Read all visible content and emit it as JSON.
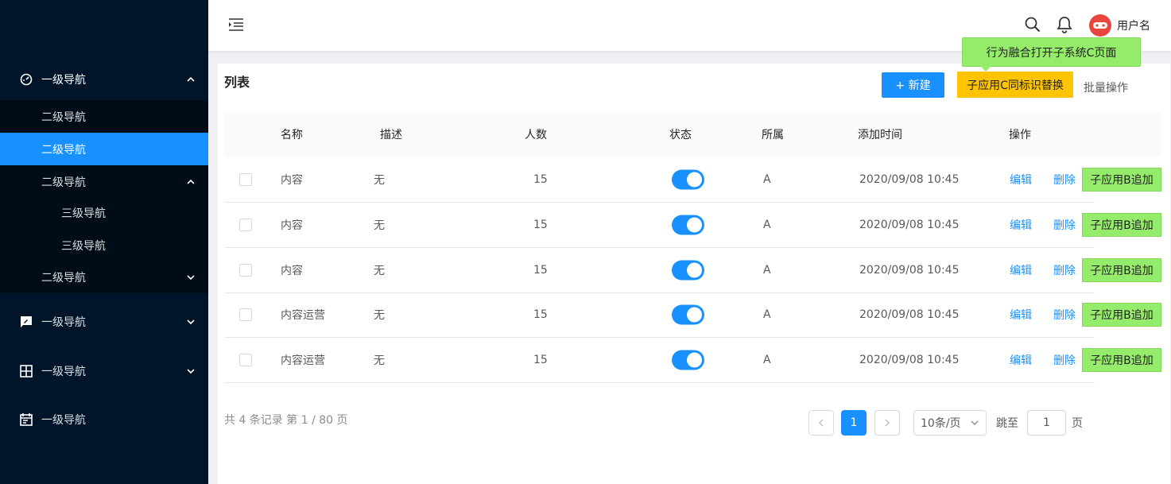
{
  "sidebar": {
    "items": [
      {
        "label": "一级导航",
        "icon": "dashboard-icon"
      },
      {
        "label": "二级导航"
      },
      {
        "label": "二级导航"
      },
      {
        "label": "二级导航"
      },
      {
        "label": "三级导航"
      },
      {
        "label": "三级导航"
      },
      {
        "label": "二级导航"
      },
      {
        "label": "一级导航",
        "icon": "feedback-icon"
      },
      {
        "label": "一级导航",
        "icon": "grid-icon"
      },
      {
        "label": "一级导航",
        "icon": "calendar-icon"
      }
    ]
  },
  "header": {
    "username": "用户名"
  },
  "card": {
    "title": "列表",
    "new_button": "+ 新建",
    "replace_button": "子应用C同标识替换",
    "batch": "批量操作",
    "tooltip": "行为融合打开子系统C页面"
  },
  "table": {
    "columns": [
      "名称",
      "描述",
      "人数",
      "状态",
      "所属",
      "添加时间",
      "操作"
    ],
    "rows": [
      {
        "name": "内容",
        "desc": "无",
        "count": "15",
        "status": "on",
        "owner": "A",
        "time": "2020/09/08 10:45",
        "edit": "编辑",
        "delete": "删除",
        "append": "子应用B追加"
      },
      {
        "name": "内容",
        "desc": "无",
        "count": "15",
        "status": "on",
        "owner": "A",
        "time": "2020/09/08 10:45",
        "edit": "编辑",
        "delete": "删除",
        "append": "子应用B追加"
      },
      {
        "name": "内容",
        "desc": "无",
        "count": "15",
        "status": "on",
        "owner": "A",
        "time": "2020/09/08 10:45",
        "edit": "编辑",
        "delete": "删除",
        "append": "子应用B追加"
      },
      {
        "name": "内容运营",
        "desc": "无",
        "count": "15",
        "status": "on",
        "owner": "A",
        "time": "2020/09/08 10:45",
        "edit": "编辑",
        "delete": "删除",
        "append": "子应用B追加"
      },
      {
        "name": "内容运营",
        "desc": "无",
        "count": "15",
        "status": "on",
        "owner": "A",
        "time": "2020/09/08 10:45",
        "edit": "编辑",
        "delete": "删除",
        "append": "子应用B追加"
      }
    ]
  },
  "pagination": {
    "total": "共 4 条记录 第 1 / 80 页",
    "current": "1",
    "page_size": "10条/页",
    "jump_label": "跳至",
    "jump_value": "1",
    "page_unit": "页"
  },
  "colors": {
    "primary": "#1890ff",
    "sidebar": "#001529",
    "yellow": "#ffc400",
    "green": "#95eb6a",
    "avatar": "#e8453c"
  }
}
